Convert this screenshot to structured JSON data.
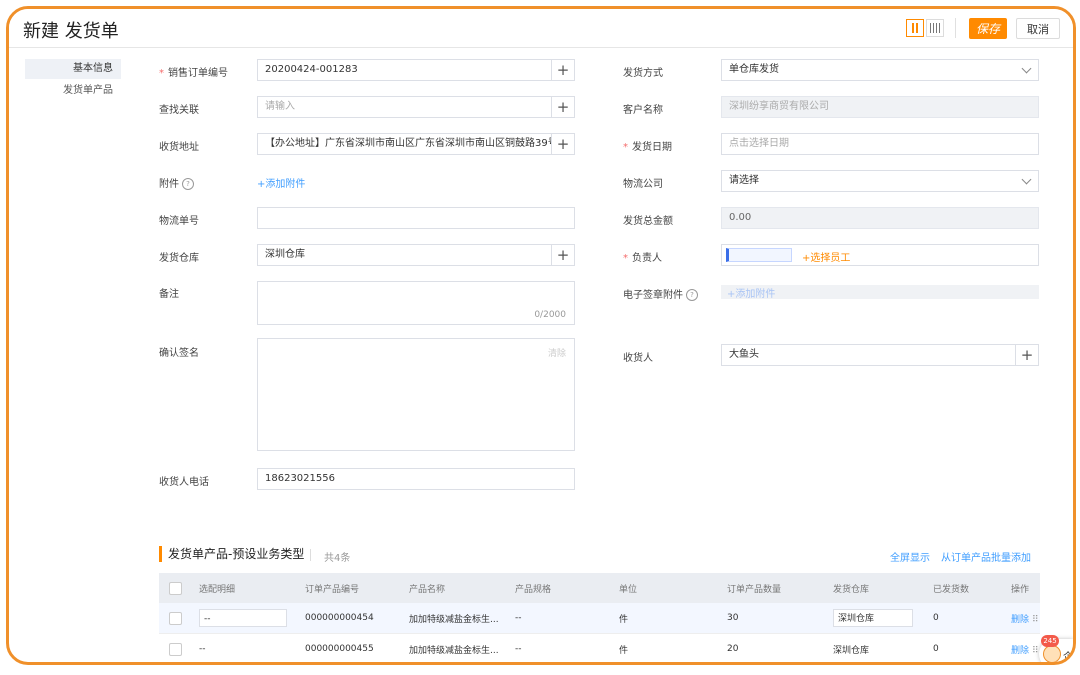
{
  "header": {
    "title": "新建 发货单",
    "save_label": "保存",
    "cancel_label": "取消"
  },
  "sidenav": {
    "items": [
      {
        "label": "基本信息"
      },
      {
        "label": "发货单产品"
      }
    ]
  },
  "form": {
    "sales_order_no": {
      "label": "销售订单编号",
      "value": "20200424-001283"
    },
    "find_related": {
      "label": "查找关联",
      "placeholder": "请输入"
    },
    "ship_address": {
      "label": "收货地址",
      "value": "【办公地址】广东省深圳市南山区广东省深圳市南山区铜鼓路39号大"
    },
    "attachment": {
      "label": "附件",
      "link": "+添加附件"
    },
    "tracking_no": {
      "label": "物流单号",
      "value": ""
    },
    "warehouse": {
      "label": "发货仓库",
      "value": "深圳仓库"
    },
    "remark": {
      "label": "备注",
      "counter": "0/2000"
    },
    "confirm_sign": {
      "label": "确认签名",
      "clear": "清除"
    },
    "receiver_phone": {
      "label": "收货人电话",
      "value": "18623021556"
    },
    "ship_method": {
      "label": "发货方式",
      "value": "单仓库发货"
    },
    "customer_name": {
      "label": "客户名称",
      "value": "深圳纷享商贸有限公司"
    },
    "ship_date": {
      "label": "发货日期",
      "placeholder": "点击选择日期"
    },
    "logistics_company": {
      "label": "物流公司",
      "value": "请选择"
    },
    "total_amount": {
      "label": "发货总金额",
      "value": "0.00"
    },
    "owner": {
      "label": "负责人",
      "link": "+选择员工"
    },
    "esign_attachment": {
      "label": "电子签章附件",
      "link": "+添加附件"
    },
    "receiver": {
      "label": "收货人",
      "value": "大鱼头"
    }
  },
  "products": {
    "title": "发货单产品-预设业务类型",
    "count": "共4条",
    "fullscreen": "全屏显示",
    "batch_add": "从订单产品批量添加",
    "columns": [
      "",
      "选配明细",
      "订单产品编号",
      "产品名称",
      "产品规格",
      "单位",
      "订单产品数量",
      "发货仓库",
      "已发货数",
      "操作"
    ],
    "rows": [
      {
        "detail": "--",
        "code": "000000000454",
        "name": "加加特级减盐金标生...",
        "spec": "--",
        "unit": "件",
        "qty": "30",
        "warehouse": "深圳仓库",
        "shipped": "0",
        "action": "删除"
      },
      {
        "detail": "--",
        "code": "000000000455",
        "name": "加加特级减盐金标生...",
        "spec": "--",
        "unit": "件",
        "qty": "20",
        "warehouse": "深圳仓库",
        "shipped": "0",
        "action": "删除"
      }
    ]
  },
  "float_badge": {
    "count": "245",
    "text": "企"
  },
  "colors": {
    "accent": "#ff8a00",
    "frame": "#f0902a",
    "link": "#409eff",
    "required": "#f56c6c"
  }
}
